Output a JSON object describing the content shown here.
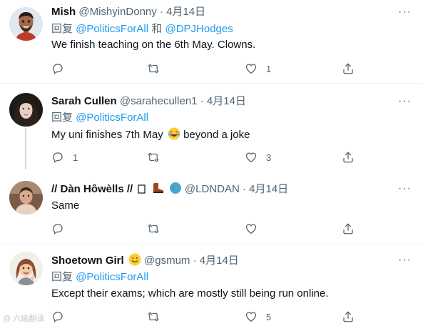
{
  "tweets": [
    {
      "name": "Mish",
      "handle": "@MishyinDonny",
      "dot": "·",
      "time": "4月14日",
      "reply_prefix": "回复",
      "mention1": "@PoliticsForAll",
      "reply_and": "和",
      "mention2": "@DPJHodges",
      "text": "We finish teaching on the 6th May. Clowns.",
      "counts": {
        "reply": "",
        "retweet": "",
        "like": "1"
      }
    },
    {
      "name": "Sarah Cullen",
      "handle": "@sarahecullen1",
      "dot": "·",
      "time": "4月14日",
      "reply_prefix": "回复",
      "mention1": "@PoliticsForAll",
      "text": "My uni finishes 7th May",
      "text_after": "beyond a joke",
      "counts": {
        "reply": "1",
        "retweet": "",
        "like": "3"
      }
    },
    {
      "name": "// Dàn Hôwèlls //",
      "handle": "@LDNDAN",
      "dot": "·",
      "time": "4月14日",
      "text": "Same",
      "counts": {
        "reply": "",
        "retweet": "",
        "like": ""
      }
    },
    {
      "name": "Shoetown Girl",
      "handle": "@gsmum",
      "dot": "·",
      "time": "4月14日",
      "reply_prefix": "回复",
      "mention1": "@PoliticsForAll",
      "text": "Except their exams; which are mostly still being run online.",
      "counts": {
        "reply": "",
        "retweet": "",
        "like": "5"
      }
    }
  ],
  "more_label": "···",
  "watermark": "@ 六级翻译",
  "icons": [
    "reply-icon",
    "retweet-icon",
    "like-icon",
    "share-icon",
    "more-icon"
  ],
  "colors": {
    "mention": "#1d9bf0",
    "secondary": "#536471",
    "separator": "#eff3f4"
  }
}
